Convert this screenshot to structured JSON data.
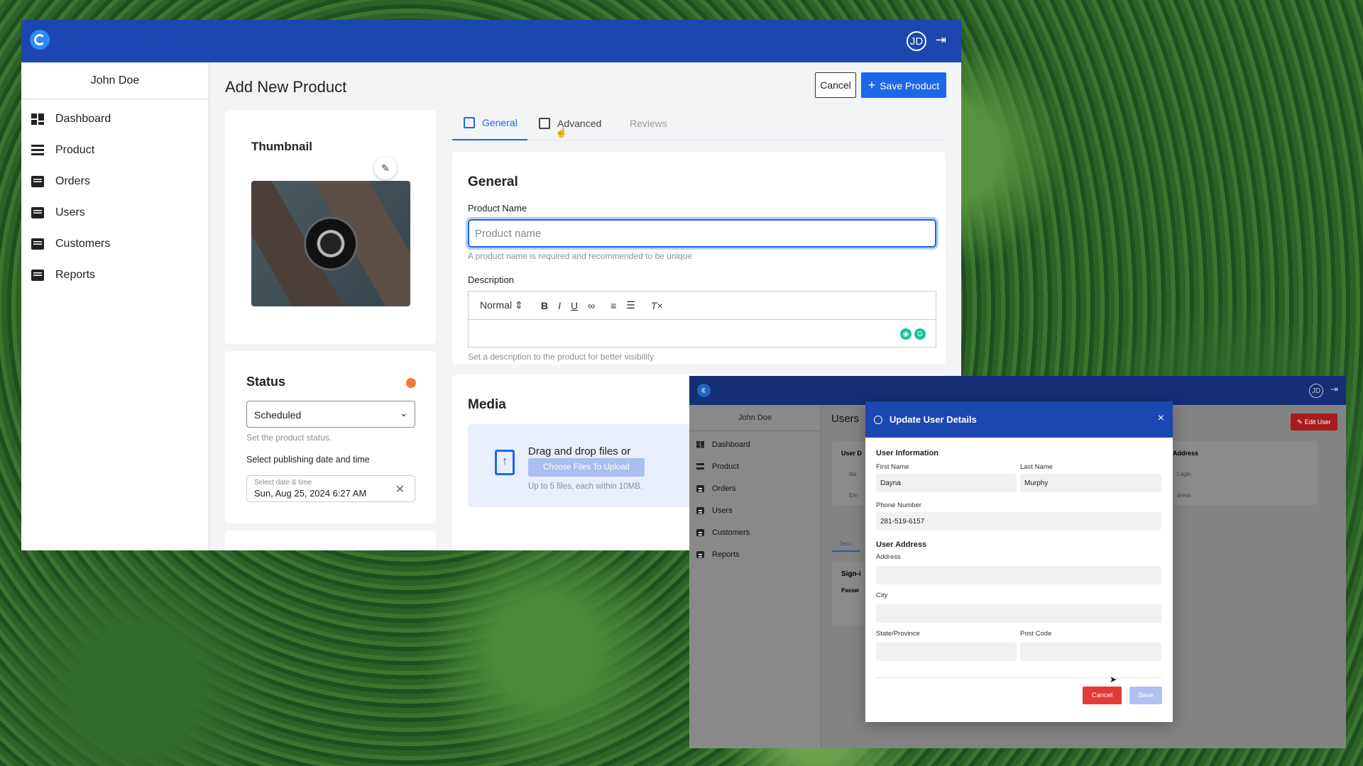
{
  "main_window": {
    "avatar": "JD",
    "user_name": "John Doe",
    "nav": [
      "Dashboard",
      "Product",
      "Orders",
      "Users",
      "Customers",
      "Reports"
    ],
    "page_title": "Add New Product",
    "cancel_label": "Cancel",
    "save_label": "Save Product",
    "thumbnail_title": "Thumbnail",
    "status": {
      "title": "Status",
      "dot_color": "#f47a36",
      "selected": "Scheduled",
      "help": "Set the product status.",
      "date_label": "Select publishing date and time",
      "date_small": "Select date & time",
      "date_value": "Sun, Aug 25, 2024 6:27 AM"
    },
    "tabs": [
      "General",
      "Advanced",
      "Reviews"
    ],
    "general": {
      "title": "General",
      "name_label": "Product Name",
      "name_placeholder": "Product name",
      "name_help": "A product name is required and recommended to be unique",
      "desc_label": "Description",
      "editor_format": "Normal",
      "desc_help": "Set a description to the product for better visibility."
    },
    "media": {
      "title": "Media",
      "drop_text": "Drag and drop files or",
      "choose_label": "Choose Files To Upload",
      "drop_help": "Up to 5 files, each within 10MB."
    }
  },
  "second_window": {
    "avatar": "JD",
    "user_name": "John Doe",
    "nav": [
      "Dashboard",
      "Product",
      "Orders",
      "Users",
      "Customers",
      "Reports"
    ],
    "page_title": "Users",
    "edit_user_label": "Edit User",
    "bg_fragments": [
      "User D",
      "Na",
      "Em",
      "Secu",
      "Sign-i",
      "Passw",
      "Address",
      "Login",
      "dress"
    ]
  },
  "modal": {
    "title": "Update User Details",
    "close": "×",
    "section_info": "User Information",
    "first_name_label": "First Name",
    "first_name": "Dayna",
    "last_name_label": "Last Name",
    "last_name": "Murphy",
    "phone_label": "Phone Number",
    "phone": "281-519-6157",
    "section_address": "User Address",
    "address_label": "Address",
    "city_label": "City",
    "state_label": "State/Province",
    "post_code_label": "Post Code",
    "cancel_label": "Cancel",
    "save_label": "Save"
  },
  "colors": {
    "brand": "#1c46b0",
    "primary": "#1d67e8",
    "danger": "#e23b35"
  }
}
